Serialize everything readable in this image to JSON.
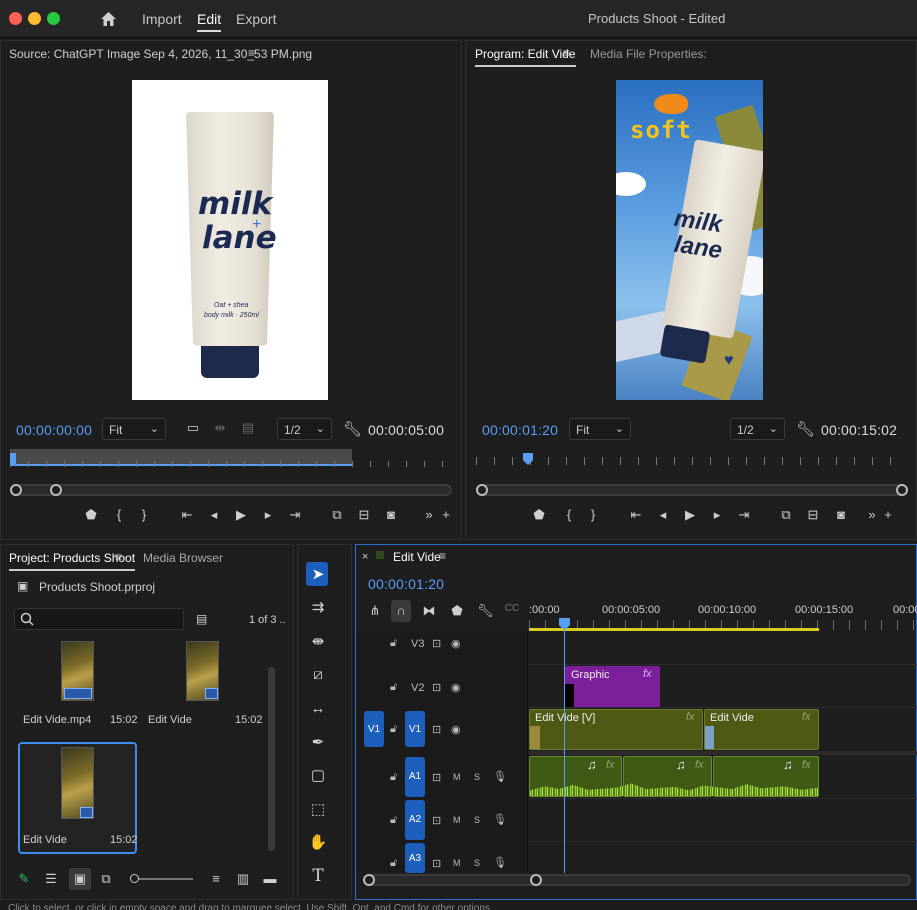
{
  "app": {
    "title": "Products Shoot - Edited",
    "menu": [
      "Import",
      "Edit",
      "Export"
    ],
    "active_menu": "Edit"
  },
  "source_monitor": {
    "tab": "Source: ChatGPT Image Sep 4, 2026, 11_30_53 PM.png",
    "timecode": "00:00:00:00",
    "fit": "Fit",
    "resolution": "1/2",
    "duration": "00:00:05:00"
  },
  "program_monitor": {
    "tab": "Program: Edit Vide",
    "tab2": "Media File Properties:",
    "timecode": "00:00:01:20",
    "fit": "Fit",
    "resolution": "1/2",
    "duration": "00:00:15:02"
  },
  "product": {
    "brand_line1": "milk",
    "brand_line2": "lane",
    "plus": "+",
    "desc_line1": "Oat + shea",
    "desc_line2": "body milk · 250ml",
    "overlay_word": "soft"
  },
  "project_panel": {
    "tab": "Project: Products Shoot",
    "tab2": "Media Browser",
    "file": "Products Shoot.prproj",
    "count": "1 of 3 ..",
    "items": [
      {
        "name": "Edit Vide.mp4",
        "duration": "15:02"
      },
      {
        "name": "Edit Vide",
        "duration": "15:02"
      },
      {
        "name": "Edit Vide",
        "duration": "15:02"
      }
    ]
  },
  "timeline": {
    "tab": "Edit Vide",
    "timecode": "00:00:01:20",
    "ruler": [
      ":00:00",
      "00:00:05:00",
      "00:00:10:00",
      "00:00:15:00",
      "00:00"
    ],
    "tracks": {
      "v3": "V3",
      "v2": "V2",
      "v1": "V1",
      "v1_source": "V1",
      "a1": "A1",
      "a2": "A2",
      "a3": "A3",
      "mute": "M",
      "solo": "S"
    },
    "clips": {
      "graphic": "Graphic",
      "video1": "Edit Vide [V]",
      "video2": "Edit Vide",
      "fx": "fx"
    }
  },
  "colors": {
    "accent_blue": "#5a9df5",
    "clip_video": "#4c5a14",
    "clip_graphic": "#7c1f9a",
    "clip_audio": "#3e5a14",
    "track_button": "#1d5fbd",
    "playhead_yellow": "#d8cc1e"
  },
  "status": {
    "hint": "Click to select, or click in empty space and drag to marquee select. Use Shift, Opt, and Cmd for other options."
  }
}
